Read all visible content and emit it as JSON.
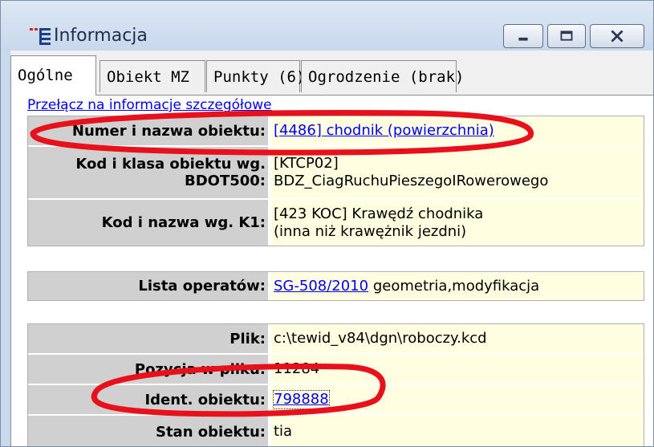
{
  "window": {
    "title": "Informacja",
    "icon": "list-icon",
    "buttons": {
      "minimize": "minimize-icon",
      "maximize": "maximize-icon",
      "close": "close-icon"
    }
  },
  "tabs": [
    {
      "label": "Ogólne",
      "active": true
    },
    {
      "label": "Obiekt MZ",
      "active": false
    },
    {
      "label": "Punkty (6)",
      "active": false
    },
    {
      "label": "Ogrodzenie (brak)",
      "active": false
    }
  ],
  "detail_link": "Przełącz na informacje szczegółowe",
  "rows": {
    "numer_key": "Numer i nazwa obiektu:",
    "numer_val": "[4486] chodnik (powierzchnia)",
    "kod_key_1": "Kod i klasa obiektu wg.",
    "kod_key_2": "BDOT500:",
    "kod_val_1": "[KTCP02]",
    "kod_val_2": "BDZ_CiagRuchuPieszegoIRowerowego",
    "k1_key": "Kod i nazwa wg. K1:",
    "k1_val": "[423 KOC] Krawędź chodnika (inna niż krawężnik jezdni)",
    "operaty_key": "Lista operatów:",
    "operaty_link": "SG-508/2010",
    "operaty_rest": " geometria,modyfikacja",
    "plik_key": "Plik:",
    "plik_val": "c:\\tewid_v84\\dgn\\roboczy.kcd",
    "pozycja_key": "Pozycja w pliku:",
    "pozycja_val": "11284",
    "ident_key": "Ident. obiektu:",
    "ident_val": "798888",
    "stan_key": "Stan obiektu:",
    "stan_val": "tia"
  },
  "colors": {
    "annotation": "#e8101a",
    "value_bg": "#fffee1",
    "key_bg": "#d0d0d0",
    "link": "#0000ee"
  }
}
